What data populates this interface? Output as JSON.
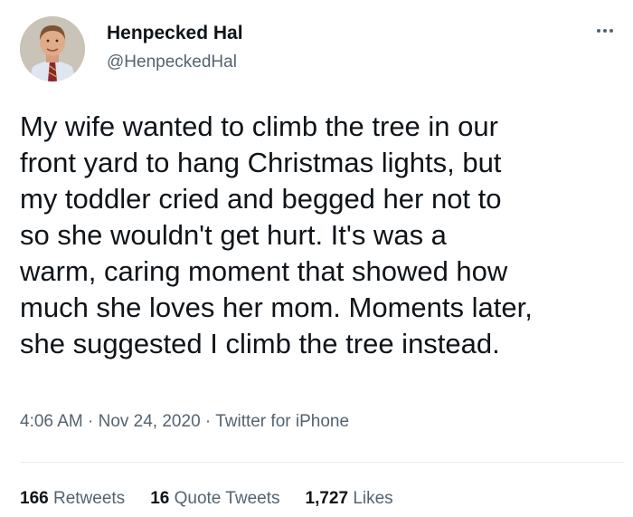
{
  "tweet": {
    "author": {
      "display_name": "Henpecked Hal",
      "handle": "@HenpeckedHal"
    },
    "text": "My wife wanted to climb the tree in our\nfront yard to hang Christmas lights, but\nmy toddler cried and begged her not to\nso she wouldn't get hurt. It's was a\nwarm, caring moment that showed how\nmuch she loves her mom. Moments later,\nshe suggested I climb the tree instead.",
    "time": "4:06 AM",
    "separator": "·",
    "date": "Nov 24, 2020",
    "source": "Twitter for iPhone",
    "stats": {
      "retweets_count": "166",
      "retweets_label": "Retweets",
      "quote_count": "16",
      "quote_label": "Quote Tweets",
      "likes_count": "1,727",
      "likes_label": "Likes"
    }
  },
  "icons": {
    "more": "more-icon"
  }
}
